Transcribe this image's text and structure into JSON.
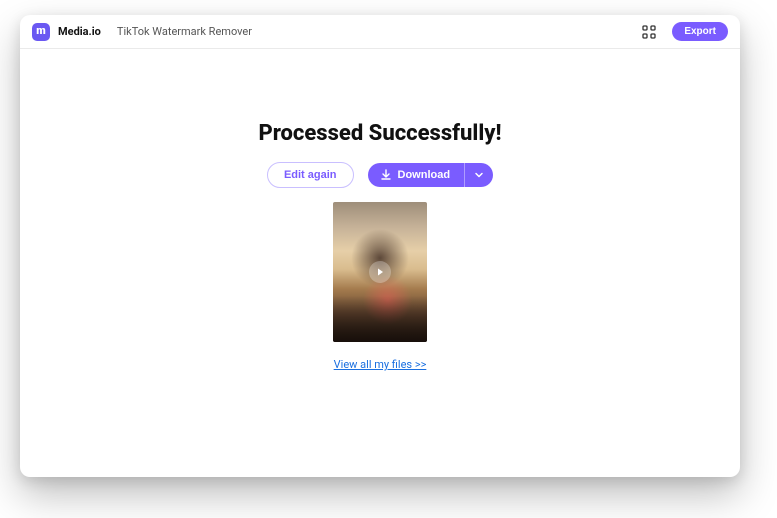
{
  "header": {
    "brand": "Media.io",
    "tool_name": "TikTok Watermark Remover",
    "export_label": "Export",
    "logo_icon": "media-logo",
    "grid_icon": "apps-grid"
  },
  "main": {
    "headline": "Processed Successfully!",
    "edit_label": "Edit again",
    "download_label": "Download",
    "download_icon": "download-icon",
    "chevron_icon": "chevron-down",
    "play_icon": "play-icon",
    "view_files_label": "View all my files >>"
  },
  "colors": {
    "accent": "#7a5cff",
    "link": "#1a6fe0"
  }
}
